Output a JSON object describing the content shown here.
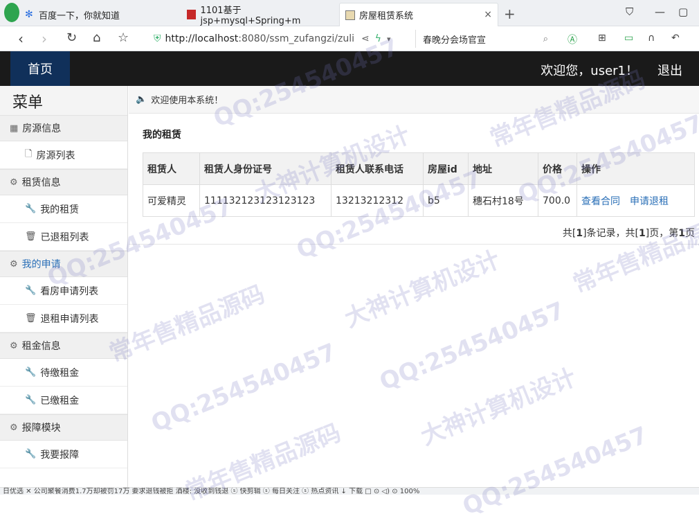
{
  "browser": {
    "tabs": [
      {
        "label": "百度一下，你就知道"
      },
      {
        "label": "1101基于jsp+mysql+Spring+m"
      },
      {
        "label": "房屋租赁系统",
        "close": "×"
      }
    ],
    "newtab": "+",
    "url_host": "http://localhost",
    "url_rest": ":8080/ssm_zufangzi/zuli",
    "search_text": "春晚分会场官宣"
  },
  "header": {
    "home_label": "首页",
    "welcome": "欢迎您，user1！",
    "logout": "退出"
  },
  "sidebar": {
    "title": "菜单",
    "groups": [
      {
        "label": "房源信息",
        "items": [
          {
            "label": "房源列表"
          }
        ]
      },
      {
        "label": "租赁信息",
        "items": [
          {
            "label": "我的租赁"
          },
          {
            "label": "已退租列表"
          }
        ]
      },
      {
        "label": "我的申请",
        "items": [
          {
            "label": "看房申请列表"
          },
          {
            "label": "退租申请列表"
          }
        ]
      },
      {
        "label": "租金信息",
        "items": [
          {
            "label": "待缴租金"
          },
          {
            "label": "已缴租金"
          }
        ]
      },
      {
        "label": "报障模块",
        "items": [
          {
            "label": "我要报障"
          }
        ]
      }
    ]
  },
  "main": {
    "notice": "欢迎使用本系统！",
    "section_title": "我的租赁",
    "table": {
      "columns": [
        "租赁人",
        "租赁人身份证号",
        "租赁人联系电话",
        "房屋id",
        "地址",
        "价格",
        "操作"
      ],
      "rows": [
        {
          "name": "可爱精灵",
          "idcard": "111132123123123123",
          "phone": "13213212312",
          "house_id": "b5",
          "address": "穗石村18号",
          "price": "700.0",
          "action1": "查看合同",
          "action2": "申请退租"
        }
      ]
    },
    "pager": {
      "p1": "共[",
      "total": "1",
      "p2": "]条记录，共[",
      "pages": "1",
      "p3": "]页，第",
      "current": "1",
      "p4": "页"
    }
  },
  "statusbar": {
    "text": "日优选    ✕ 公司聚餐消费1.7万却被罚17万  要求退钱被拒  酒楼: 没收到钱退    ⓢ 快剪辑   ⓢ 每日关注   ⓢ 热点资讯                      ↓ 下载    □ ⊙   ◁)   ⊙  100%"
  },
  "watermarks": [
    "QQ:254540457",
    "常年售精品源码",
    "大神计算机设计"
  ],
  "colors": {
    "header_bg": "#1a1a1a",
    "home_bg": "#10305a",
    "link": "#2a6fb7"
  }
}
